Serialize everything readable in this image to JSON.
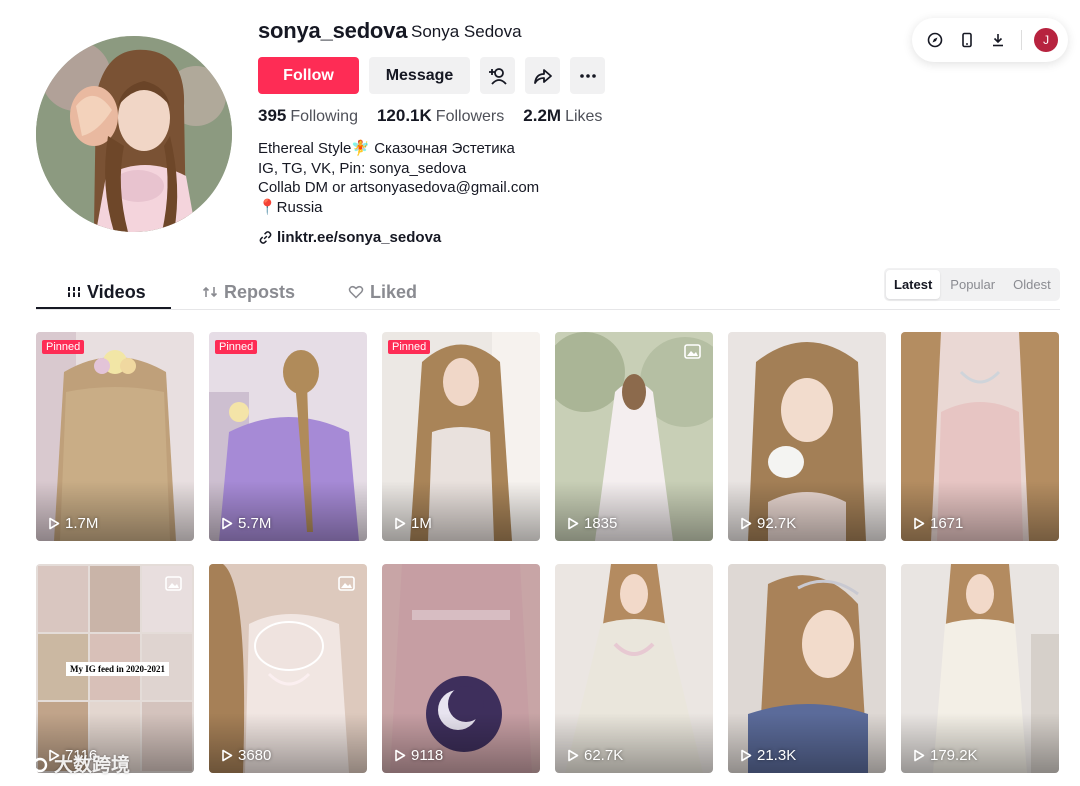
{
  "profile": {
    "username": "sonya_sedova",
    "display_name": "Sonya Sedova",
    "follow_label": "Follow",
    "message_label": "Message",
    "stats": {
      "following_value": "395",
      "following_label": "Following",
      "followers_value": "120.1K",
      "followers_label": "Followers",
      "likes_value": "2.2M",
      "likes_label": "Likes"
    },
    "bio_lines": [
      "Ethereal Style🧚 Сказочная Эстетика",
      "IG, TG, VK, Pin: sonya_sedova",
      "Collab DM or artsonyasedova@gmail.com",
      "📍Russia"
    ],
    "link": "linktr.ee/sonya_sedova"
  },
  "toolbar": {
    "user_initial": "J",
    "user_avatar_color": "#b7233f"
  },
  "tabs": [
    {
      "label": "Videos",
      "icon": "grid-icon",
      "active": true
    },
    {
      "label": "Reposts",
      "icon": "repost-icon",
      "active": false
    },
    {
      "label": "Liked",
      "icon": "liked-heart-icon",
      "active": false
    }
  ],
  "sort": {
    "options": [
      "Latest",
      "Popular",
      "Oldest"
    ],
    "selected": "Latest"
  },
  "pinned_label": "Pinned",
  "videos": [
    {
      "views": "1.7M",
      "pinned": true,
      "multi": false
    },
    {
      "views": "5.7M",
      "pinned": true,
      "multi": false
    },
    {
      "views": "1M",
      "pinned": true,
      "multi": false
    },
    {
      "views": "1835",
      "pinned": false,
      "multi": true
    },
    {
      "views": "92.7K",
      "pinned": false,
      "multi": false
    },
    {
      "views": "1671",
      "pinned": false,
      "multi": false
    },
    {
      "views": "7116",
      "pinned": false,
      "multi": true,
      "overlay_text": "My IG feed in 2020-2021"
    },
    {
      "views": "3680",
      "pinned": false,
      "multi": true
    },
    {
      "views": "9118",
      "pinned": false,
      "multi": false
    },
    {
      "views": "62.7K",
      "pinned": false,
      "multi": false
    },
    {
      "views": "21.3K",
      "pinned": false,
      "multi": false
    },
    {
      "views": "179.2K",
      "pinned": false,
      "multi": false
    }
  ],
  "watermark": "大数跨境",
  "colors": {
    "accent": "#fe2c55",
    "text": "#161823",
    "secondary_text": "#4e5058",
    "muted": "#8a8b91",
    "button_gray": "#f1f1f2"
  }
}
